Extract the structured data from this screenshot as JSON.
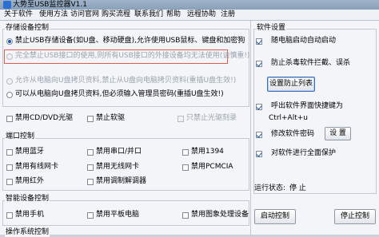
{
  "window": {
    "title": "大势至USB监控器V1.1"
  },
  "menu": [
    "关于软件",
    "使用方法",
    "访问官网",
    "购买流程",
    "联系我们",
    "帮助",
    "远程协助",
    "注册"
  ],
  "storage": {
    "title": "存储设备控制",
    "options": [
      {
        "label": "禁止USB存储设备(如U盘、移动硬盘),允许使用USB鼠标、键盘和加密狗",
        "selected": true,
        "disabled": false
      },
      {
        "label": "完全禁止USB接口的使用,则所有USB接口的外接设备均无法使用(请慎重!)",
        "selected": false,
        "disabled": true
      },
      {
        "label": "允许从电脑向U盘拷贝资料,禁止从U盘向电脑拷贝资料(重插U盘生效!)",
        "selected": false,
        "disabled": true
      },
      {
        "label": "可以从电脑向U盘拷贝资料,但必须输入管理员密码(重插U盘生效!)",
        "selected": false,
        "disabled": false
      }
    ],
    "extras": [
      {
        "label": "禁用CD/DVD光驱",
        "checked": false,
        "disabled": false
      },
      {
        "label": "禁止软驱",
        "checked": false,
        "disabled": false
      },
      {
        "label": "只禁止光驱刻录",
        "checked": false,
        "disabled": true
      }
    ]
  },
  "ports": {
    "title": "端口控制",
    "items": [
      {
        "label": "禁用蓝牙",
        "checked": false
      },
      {
        "label": "禁用串口/并口",
        "checked": false
      },
      {
        "label": "禁用1394",
        "checked": false
      },
      {
        "label": "禁用有线网卡",
        "checked": false
      },
      {
        "label": "禁用无线网卡",
        "checked": false
      },
      {
        "label": "禁用PCMCIA",
        "checked": false
      },
      {
        "label": "禁用红外",
        "checked": false
      },
      {
        "label": "禁用调制解调器",
        "checked": false
      }
    ]
  },
  "smart": {
    "title": "智能设备控制",
    "items": [
      {
        "label": "禁用手机",
        "checked": false
      },
      {
        "label": "禁用平板电脑",
        "checked": false
      },
      {
        "label": "禁用图象处理设备",
        "checked": false
      }
    ]
  },
  "os_section": {
    "title": "操作系统控制"
  },
  "settings": {
    "title": "软件设置",
    "autostart": {
      "label": "随电脑启动自动启动",
      "checked": true
    },
    "antikill": {
      "label": "防止杀毒软件拦截、误杀",
      "checked": true
    },
    "antikill_button": "设置防止列表",
    "hotkey": {
      "label": "呼出软件界面快捷键为",
      "checked": true
    },
    "hotkey_value": "Ctrl+Alt+u",
    "password": {
      "label": "修改软件密码",
      "checked": true
    },
    "password_button": "设 置",
    "protect": {
      "label": "对软件进行全面保护",
      "checked": true
    }
  },
  "status": {
    "label": "运行状态:",
    "value": "停 止"
  },
  "actions": {
    "start": "启动控制",
    "stop": "停止控制"
  }
}
